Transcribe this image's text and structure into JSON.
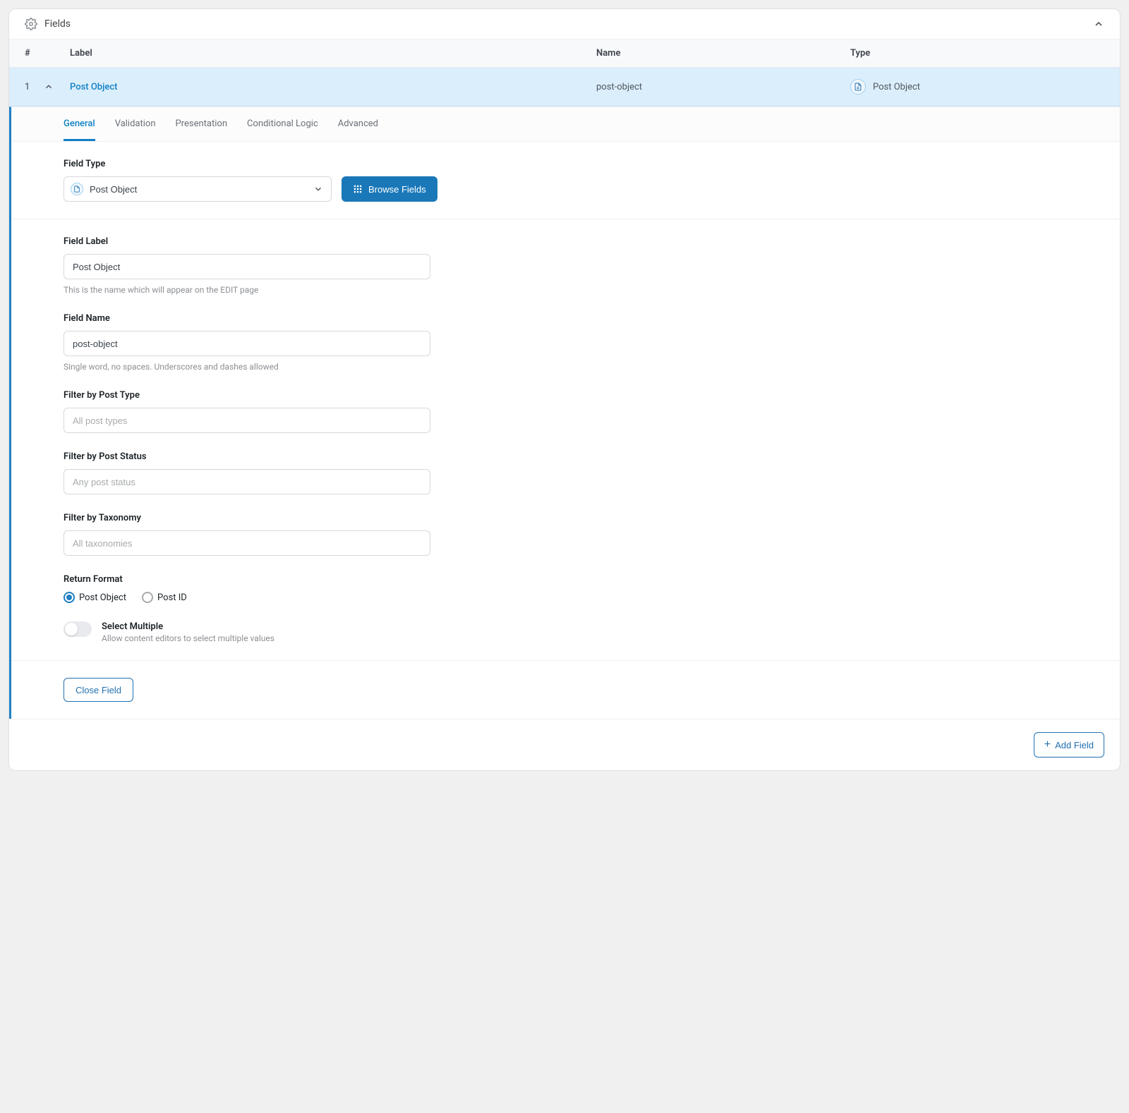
{
  "panel": {
    "title": "Fields"
  },
  "columns": {
    "num": "#",
    "label": "Label",
    "name": "Name",
    "type": "Type"
  },
  "row": {
    "num": "1",
    "label": "Post Object",
    "name": "post-object",
    "type": "Post Object"
  },
  "tabs": {
    "general": "General",
    "validation": "Validation",
    "presentation": "Presentation",
    "conditional": "Conditional Logic",
    "advanced": "Advanced"
  },
  "fieldType": {
    "label": "Field Type",
    "value": "Post Object",
    "browse": "Browse Fields"
  },
  "fieldLabel": {
    "label": "Field Label",
    "value": "Post Object",
    "help": "This is the name which will appear on the EDIT page"
  },
  "fieldName": {
    "label": "Field Name",
    "value": "post-object",
    "help": "Single word, no spaces. Underscores and dashes allowed"
  },
  "filterPostType": {
    "label": "Filter by Post Type",
    "placeholder": "All post types"
  },
  "filterPostStatus": {
    "label": "Filter by Post Status",
    "placeholder": "Any post status"
  },
  "filterTaxonomy": {
    "label": "Filter by Taxonomy",
    "placeholder": "All taxonomies"
  },
  "returnFormat": {
    "label": "Return Format",
    "options": {
      "postObject": "Post Object",
      "postId": "Post ID"
    }
  },
  "selectMultiple": {
    "title": "Select Multiple",
    "desc": "Allow content editors to select multiple values"
  },
  "closeField": "Close Field",
  "addField": "Add Field"
}
